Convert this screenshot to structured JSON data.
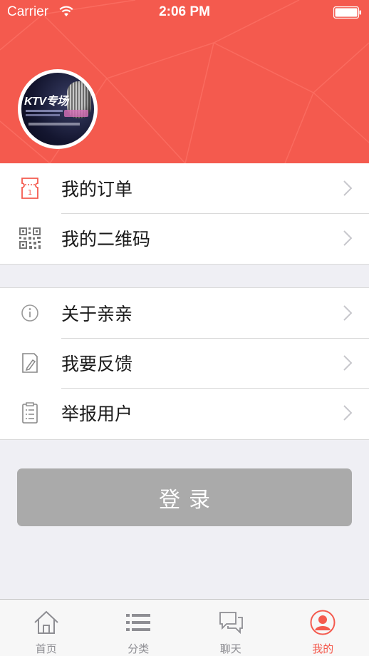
{
  "status_bar": {
    "carrier": "Carrier",
    "time": "2:06 PM"
  },
  "header": {
    "background_color": "#f45a4e",
    "avatar": {
      "label": "KTV专场"
    }
  },
  "menu_group_1": [
    {
      "label": "我的订单",
      "icon": "ticket-icon"
    },
    {
      "label": "我的二维码",
      "icon": "qr-code-icon"
    }
  ],
  "menu_group_2": [
    {
      "label": "关于亲亲",
      "icon": "info-icon"
    },
    {
      "label": "我要反馈",
      "icon": "feedback-pen-icon"
    },
    {
      "label": "举报用户",
      "icon": "clipboard-icon"
    }
  ],
  "login": {
    "label": "登录"
  },
  "tabbar": {
    "items": [
      {
        "label": "首页",
        "icon": "home-icon"
      },
      {
        "label": "分类",
        "icon": "list-icon"
      },
      {
        "label": "聊天",
        "icon": "chat-icon"
      },
      {
        "label": "我的",
        "icon": "profile-icon",
        "active": true
      }
    ],
    "active_color": "#f45a4e",
    "inactive_color": "#8e8e93"
  }
}
